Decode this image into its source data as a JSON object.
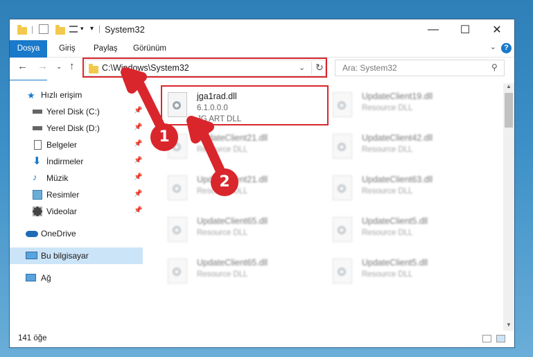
{
  "window": {
    "title": "System32"
  },
  "ribbon": {
    "tabs": [
      "Dosya",
      "Giriş",
      "Paylaş",
      "Görünüm"
    ],
    "help_label": "?"
  },
  "nav": {
    "address": "C:\\Windows\\System32",
    "search_placeholder": "Ara: System32"
  },
  "sidebar": {
    "items": [
      {
        "label": "Hızlı erişim",
        "icon": "star-icon"
      },
      {
        "label": "Yerel Disk (C:)",
        "icon": "drive-icon",
        "pinned": true
      },
      {
        "label": "Yerel Disk (D:)",
        "icon": "drive-icon",
        "pinned": true
      },
      {
        "label": "Belgeler",
        "icon": "document-icon",
        "pinned": true
      },
      {
        "label": "İndirmeler",
        "icon": "download-icon",
        "pinned": true
      },
      {
        "label": "Müzik",
        "icon": "music-icon",
        "pinned": true
      },
      {
        "label": "Resimler",
        "icon": "pictures-icon",
        "pinned": true
      },
      {
        "label": "Videolar",
        "icon": "video-icon",
        "pinned": true
      },
      {
        "label": "OneDrive",
        "icon": "cloud-icon"
      },
      {
        "label": "Bu bilgisayar",
        "icon": "computer-icon",
        "selected": true
      },
      {
        "label": "Ağ",
        "icon": "network-icon"
      }
    ]
  },
  "files": {
    "highlighted": {
      "name": "jga1rad.dll",
      "version": "6.1.0.0.0",
      "description": "JG ART DLL"
    },
    "right": [
      {
        "name": "UpdateClient19.dll",
        "description": "Resource DLL"
      },
      {
        "name": "UpdateClient42.dll",
        "description": "Resource DLL"
      },
      {
        "name": "UpdateClient63.dll",
        "description": "Resource DLL"
      },
      {
        "name": "UpdateClient5.dll",
        "description": "Resource DLL"
      },
      {
        "name": "UpdateClient5.dll",
        "description": "Resource DLL"
      }
    ],
    "left": [
      {
        "name": "UpdateClient21.dll",
        "description": "Resource DLL"
      },
      {
        "name": "UpdateClient21.dll",
        "description": "Resource DLL"
      },
      {
        "name": "UpdateClient65.dll",
        "description": "Resource DLL"
      },
      {
        "name": "UpdateClient65.dll",
        "description": "Resource DLL"
      }
    ]
  },
  "status": {
    "count": "141 öğe"
  },
  "callouts": [
    "1",
    "2"
  ],
  "colors": {
    "accent": "#1979ca",
    "highlight": "#d9262c",
    "selected": "#cce4f7"
  }
}
